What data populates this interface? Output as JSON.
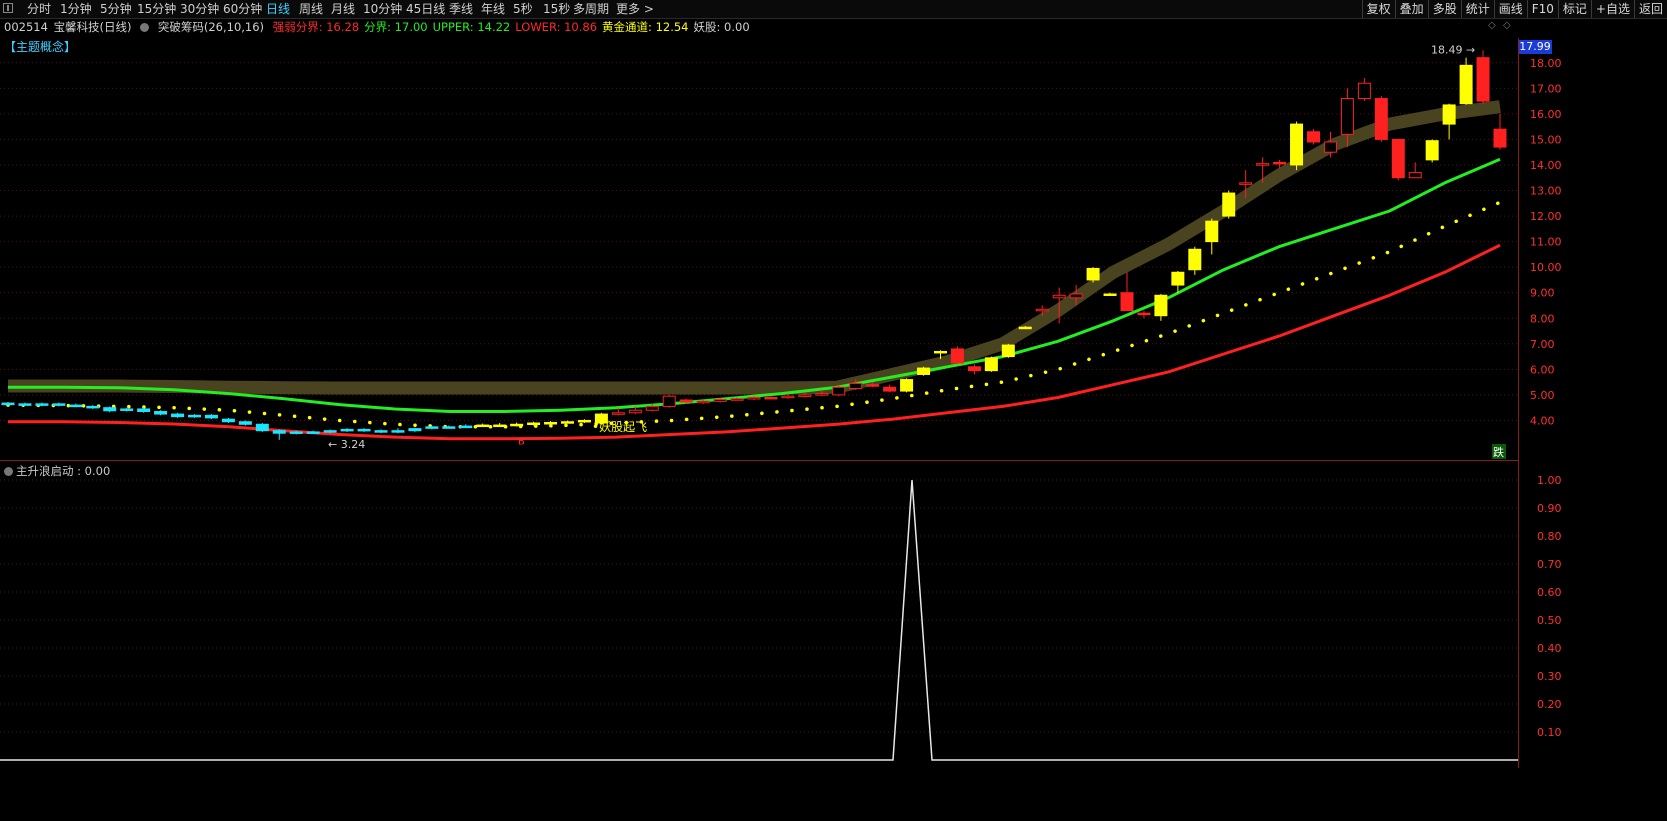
{
  "toolbar": {
    "periods": [
      "分时",
      "1分钟",
      "5分钟",
      "15分钟",
      "30分钟",
      "60分钟",
      "日线",
      "周线",
      "月线",
      "10分钟",
      "45日线",
      "季线",
      "年线",
      "5秒",
      "15秒",
      "多周期",
      "更多 >"
    ],
    "active_period": "日线",
    "right_buttons": [
      "复权",
      "叠加",
      "多股",
      "统计",
      "画线",
      "F10",
      "标记",
      "+自选",
      "返回"
    ]
  },
  "stock": {
    "code": "002514",
    "name": "宝馨科技(日线)",
    "indicator": "突破筹码(26,10,16)",
    "fields": [
      {
        "label": "强弱分界: 16.28",
        "color": "#ff2a2a"
      },
      {
        "label": "分界: 17.00",
        "color": "#22ee22"
      },
      {
        "label": "UPPER: 14.22",
        "color": "#22ee22"
      },
      {
        "label": "LOWER: 10.86",
        "color": "#ff2a2a"
      },
      {
        "label": "黄金通道: 12.54",
        "color": "#ffff00"
      },
      {
        "label": "妖股: 0.00",
        "color": "#d0d0d0"
      }
    ]
  },
  "theme_label": "【主题概念】",
  "current_price_tag": "17.99",
  "high_label": "18.49",
  "low_label": "3.24",
  "signal_label": "妖股起飞",
  "buy_marker": "B",
  "sell_marker": "跌",
  "lower_indicator": "主升浪启动 : 0.00",
  "colors": {
    "up_candle": "#ffff00",
    "down_candle": "#ff2020",
    "cold_candle": "#19e6ff",
    "upper_line": "#22ee22",
    "lower_line": "#ff2020",
    "dots": "#ffff00",
    "band": "#4a4320"
  },
  "chart_data": [
    {
      "type": "line",
      "title": "",
      "y_ticks": [
        "4.00",
        "5.00",
        "6.00",
        "7.00",
        "8.00",
        "9.00",
        "10.00",
        "11.00",
        "12.00",
        "13.00",
        "14.00",
        "15.00",
        "16.00",
        "17.00",
        "18.00"
      ],
      "ylim": [
        3.0,
        18.5
      ],
      "series": [
        {
          "name": "UPPER",
          "values": [
            5.3,
            5.3,
            5.28,
            5.2,
            5.05,
            4.85,
            4.62,
            4.45,
            4.35,
            4.35,
            4.4,
            4.5,
            4.65,
            4.85,
            5.05,
            5.3,
            5.7,
            6.1,
            6.5,
            7.1,
            7.9,
            8.8,
            9.9,
            10.8,
            11.5,
            12.2,
            13.3,
            14.22
          ]
        },
        {
          "name": "LOWER",
          "values": [
            3.95,
            3.95,
            3.92,
            3.86,
            3.75,
            3.6,
            3.45,
            3.35,
            3.28,
            3.28,
            3.3,
            3.35,
            3.45,
            3.55,
            3.7,
            3.85,
            4.05,
            4.3,
            4.55,
            4.9,
            5.4,
            5.9,
            6.6,
            7.3,
            8.1,
            8.9,
            9.8,
            10.86
          ]
        },
        {
          "name": "黄金通道",
          "values": [
            4.6,
            4.58,
            4.55,
            4.5,
            4.4,
            4.2,
            4.0,
            3.85,
            3.75,
            3.75,
            3.8,
            3.9,
            4.0,
            4.15,
            4.35,
            4.55,
            4.85,
            5.2,
            5.5,
            6.0,
            6.7,
            7.4,
            8.2,
            9.0,
            9.8,
            10.6,
            11.6,
            12.54
          ]
        },
        {
          "name": "强弱分界",
          "values": [
            5.35,
            5.35,
            5.35,
            5.33,
            5.3,
            5.28,
            5.27,
            5.27,
            5.27,
            5.27,
            5.27,
            5.27,
            5.27,
            5.27,
            5.27,
            5.3,
            5.8,
            6.3,
            7.0,
            8.3,
            9.8,
            10.9,
            12.2,
            13.6,
            14.8,
            15.6,
            16.0,
            16.28
          ]
        }
      ],
      "candles": [
        [
          4.62,
          4.68,
          4.72,
          4.58,
          "c"
        ],
        [
          4.65,
          4.62,
          4.7,
          4.58,
          "c"
        ],
        [
          4.6,
          4.65,
          4.7,
          4.55,
          "c"
        ],
        [
          4.65,
          4.6,
          4.7,
          4.55,
          "c"
        ],
        [
          4.6,
          4.58,
          4.66,
          4.52,
          "c"
        ],
        [
          4.55,
          4.5,
          4.6,
          4.45,
          "c"
        ],
        [
          4.5,
          4.38,
          4.55,
          4.32,
          "c"
        ],
        [
          4.4,
          4.45,
          4.5,
          4.35,
          "c"
        ],
        [
          4.45,
          4.35,
          4.5,
          4.3,
          "c"
        ],
        [
          4.35,
          4.25,
          4.4,
          4.2,
          "c"
        ],
        [
          4.25,
          4.15,
          4.3,
          4.1,
          "c"
        ],
        [
          4.15,
          4.2,
          4.25,
          4.1,
          "c"
        ],
        [
          4.2,
          4.1,
          4.25,
          4.05,
          "c"
        ],
        [
          4.05,
          3.95,
          4.1,
          3.9,
          "c"
        ],
        [
          3.95,
          3.85,
          4.0,
          3.8,
          "c"
        ],
        [
          3.85,
          3.6,
          3.9,
          3.55,
          "c"
        ],
        [
          3.6,
          3.5,
          3.65,
          3.24,
          "c"
        ],
        [
          3.5,
          3.55,
          3.6,
          3.45,
          "c"
        ],
        [
          3.55,
          3.52,
          3.6,
          3.48,
          "c"
        ],
        [
          3.55,
          3.6,
          3.65,
          3.5,
          "c"
        ],
        [
          3.6,
          3.65,
          3.7,
          3.55,
          "c"
        ],
        [
          3.65,
          3.6,
          3.7,
          3.55,
          "c"
        ],
        [
          3.6,
          3.55,
          3.65,
          3.5,
          "c"
        ],
        [
          3.55,
          3.6,
          3.7,
          3.5,
          "c"
        ],
        [
          3.6,
          3.68,
          3.72,
          3.55,
          "c"
        ],
        [
          3.7,
          3.75,
          3.8,
          3.65,
          "c"
        ],
        [
          3.75,
          3.72,
          3.8,
          3.68,
          "c"
        ],
        [
          3.72,
          3.78,
          3.85,
          3.7,
          "c"
        ],
        [
          3.8,
          3.82,
          3.88,
          3.75,
          "y"
        ],
        [
          3.82,
          3.8,
          3.9,
          3.75,
          "y"
        ],
        [
          3.8,
          3.85,
          3.92,
          3.76,
          "y"
        ],
        [
          3.85,
          3.9,
          3.95,
          3.8,
          "y"
        ],
        [
          3.9,
          3.92,
          3.98,
          3.85,
          "y"
        ],
        [
          3.92,
          3.95,
          4.0,
          3.88,
          "y"
        ],
        [
          3.95,
          4.0,
          4.05,
          3.9,
          "y"
        ],
        [
          3.9,
          4.25,
          4.3,
          3.85,
          "y"
        ],
        [
          4.25,
          4.3,
          4.5,
          4.2,
          "r"
        ],
        [
          4.3,
          4.4,
          4.55,
          4.25,
          "r"
        ],
        [
          4.4,
          4.55,
          4.65,
          4.35,
          "r"
        ],
        [
          4.55,
          4.95,
          5.0,
          4.5,
          "r"
        ],
        [
          4.8,
          4.72,
          4.85,
          4.65,
          "r"
        ],
        [
          4.7,
          4.75,
          4.8,
          4.65,
          "r"
        ],
        [
          4.75,
          4.82,
          4.88,
          4.7,
          "r"
        ],
        [
          4.82,
          4.85,
          4.9,
          4.78,
          "r"
        ],
        [
          4.85,
          4.9,
          4.95,
          4.8,
          "r"
        ],
        [
          4.9,
          4.88,
          4.95,
          4.84,
          "r"
        ],
        [
          4.9,
          4.95,
          5.05,
          4.85,
          "r"
        ],
        [
          4.95,
          5.0,
          5.1,
          4.9,
          "r"
        ],
        [
          5.0,
          5.05,
          5.2,
          4.95,
          "r"
        ],
        [
          5.0,
          5.3,
          5.4,
          4.95,
          "r"
        ],
        [
          5.25,
          5.45,
          5.6,
          5.2,
          "r"
        ],
        [
          5.4,
          5.35,
          5.5,
          5.3,
          "r"
        ],
        [
          5.3,
          5.15,
          5.4,
          5.1,
          "r"
        ],
        [
          5.15,
          5.6,
          5.65,
          5.1,
          "y"
        ],
        [
          5.8,
          6.05,
          6.1,
          5.75,
          "y"
        ],
        [
          6.7,
          6.7,
          6.75,
          6.4,
          "y"
        ],
        [
          6.8,
          6.25,
          6.9,
          6.2,
          "r"
        ],
        [
          6.1,
          5.95,
          6.2,
          5.8,
          "r"
        ],
        [
          5.95,
          6.45,
          6.5,
          5.9,
          "y"
        ],
        [
          6.5,
          6.95,
          7.0,
          6.45,
          "y"
        ],
        [
          7.65,
          7.65,
          7.7,
          7.65,
          "y"
        ],
        [
          8.3,
          8.35,
          8.5,
          8.1,
          "r"
        ],
        [
          8.8,
          8.9,
          9.2,
          7.8,
          "r"
        ],
        [
          8.8,
          8.95,
          9.3,
          8.5,
          "r"
        ],
        [
          9.5,
          9.95,
          10.0,
          9.4,
          "y"
        ],
        [
          8.95,
          8.95,
          9.0,
          8.9,
          "y"
        ],
        [
          9.0,
          8.3,
          9.8,
          8.3,
          "r"
        ],
        [
          8.2,
          8.15,
          8.3,
          8.0,
          "r"
        ],
        [
          8.1,
          8.9,
          8.95,
          7.9,
          "y"
        ],
        [
          9.3,
          9.8,
          9.85,
          9.0,
          "y"
        ],
        [
          9.9,
          10.7,
          10.8,
          9.7,
          "y"
        ],
        [
          11.0,
          11.8,
          11.9,
          10.5,
          "y"
        ],
        [
          12.0,
          12.9,
          13.0,
          11.9,
          "y"
        ],
        [
          13.3,
          13.3,
          13.8,
          12.7,
          "r"
        ],
        [
          14.0,
          14.05,
          14.3,
          13.3,
          "r"
        ],
        [
          14.1,
          14.05,
          14.2,
          13.9,
          "r"
        ],
        [
          14.0,
          15.6,
          15.7,
          13.8,
          "y"
        ],
        [
          15.3,
          14.9,
          15.4,
          14.8,
          "r"
        ],
        [
          14.5,
          14.9,
          15.3,
          14.3,
          "r"
        ],
        [
          15.2,
          16.6,
          17.0,
          14.7,
          "r"
        ],
        [
          16.6,
          17.2,
          17.4,
          16.5,
          "r"
        ],
        [
          16.6,
          15.0,
          16.7,
          14.9,
          "r"
        ],
        [
          15.0,
          13.5,
          15.0,
          13.4,
          "r"
        ],
        [
          13.5,
          13.7,
          14.1,
          13.5,
          "r"
        ],
        [
          14.2,
          14.95,
          15.0,
          14.1,
          "y"
        ],
        [
          15.6,
          16.35,
          16.4,
          15.0,
          "y"
        ],
        [
          16.4,
          17.9,
          18.2,
          16.35,
          "y"
        ],
        [
          18.2,
          16.5,
          18.49,
          16.4,
          "r"
        ],
        [
          15.4,
          14.7,
          16.0,
          14.6,
          "r"
        ]
      ]
    },
    {
      "type": "line",
      "title": "",
      "y_ticks": [
        "0.10",
        "0.20",
        "0.30",
        "0.40",
        "0.50",
        "0.60",
        "0.70",
        "0.80",
        "0.90",
        "1.00"
      ],
      "ylim": [
        0,
        1.0
      ],
      "series": [
        {
          "name": "主升浪启动",
          "x": [
            0,
            893,
            912,
            932,
            1518
          ],
          "values": [
            0,
            0,
            1.0,
            0,
            0
          ]
        }
      ]
    }
  ]
}
